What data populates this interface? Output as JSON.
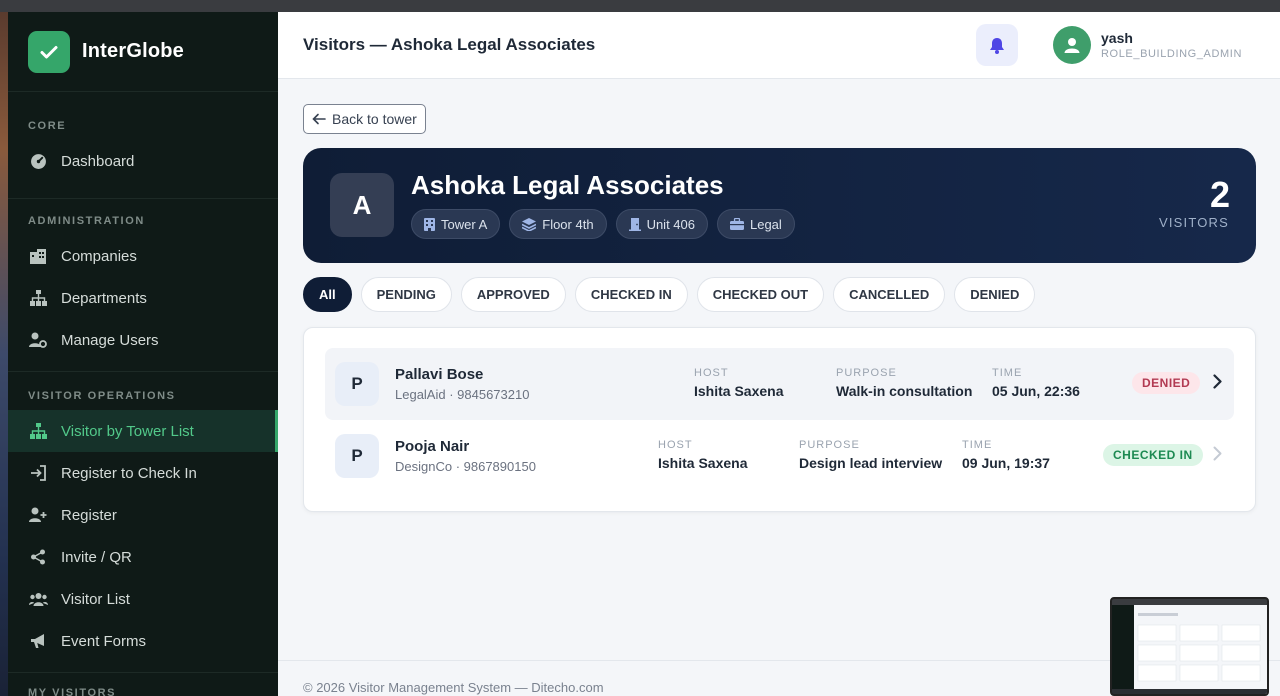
{
  "brand": {
    "name": "InterGlobe",
    "color": "#35a66a"
  },
  "sidebar": {
    "sections": [
      {
        "title": "CORE",
        "items": [
          {
            "label": "Dashboard",
            "icon": "gauge-icon"
          }
        ]
      },
      {
        "title": "ADMINISTRATION",
        "items": [
          {
            "label": "Companies",
            "icon": "building-icon"
          },
          {
            "label": "Departments",
            "icon": "sitemap-icon"
          },
          {
            "label": "Manage Users",
            "icon": "user-gear-icon"
          }
        ]
      },
      {
        "title": "VISITOR OPERATIONS",
        "items": [
          {
            "label": "Visitor by Tower List",
            "icon": "sitemap-icon",
            "active": true
          },
          {
            "label": "Register to Check In",
            "icon": "sign-in-icon"
          },
          {
            "label": "Register",
            "icon": "user-plus-icon"
          },
          {
            "label": "Invite / QR",
            "icon": "share-icon"
          },
          {
            "label": "Visitor List",
            "icon": "users-icon"
          },
          {
            "label": "Event Forms",
            "icon": "megaphone-icon"
          }
        ]
      },
      {
        "title": "MY VISITORS",
        "items": []
      }
    ]
  },
  "header": {
    "title": "Visitors — Ashoka Legal Associates",
    "user": {
      "name": "yash",
      "role": "ROLE_BUILDING_ADMIN"
    }
  },
  "back_label": "Back to tower",
  "company": {
    "initial": "A",
    "name": "Ashoka Legal Associates",
    "chips": [
      {
        "label": "Tower A",
        "icon": "building-icon"
      },
      {
        "label": "Floor 4th",
        "icon": "layers-icon"
      },
      {
        "label": "Unit 406",
        "icon": "door-icon"
      },
      {
        "label": "Legal",
        "icon": "briefcase-icon"
      }
    ],
    "visitor_count": "2",
    "visitor_count_label": "VISITORS"
  },
  "filters": [
    "All",
    "PENDING",
    "APPROVED",
    "CHECKED IN",
    "CHECKED OUT",
    "CANCELLED",
    "DENIED"
  ],
  "labels": {
    "host": "HOST",
    "purpose": "PURPOSE",
    "time": "TIME"
  },
  "visitors": [
    {
      "initial": "P",
      "name": "Pallavi Bose",
      "sub": "LegalAid · 9845673210",
      "host": "Ishita Saxena",
      "purpose": "Walk-in consultation",
      "time": "05 Jun, 22:36",
      "status": "DENIED"
    },
    {
      "initial": "P",
      "name": "Pooja Nair",
      "sub": "DesignCo · 9867890150",
      "host": "Ishita Saxena",
      "purpose": "Design lead interview",
      "time": "09 Jun, 19:37",
      "status": "CHECKED IN"
    }
  ],
  "footer": "© 2026 Visitor Management System — Ditecho.com",
  "colors": {
    "sidebar_bg": "#0f1a17",
    "accent": "#35a66a",
    "hero_bg": "#0f1d36",
    "denied": "#b23a52",
    "checked_in": "#1d8a52"
  }
}
